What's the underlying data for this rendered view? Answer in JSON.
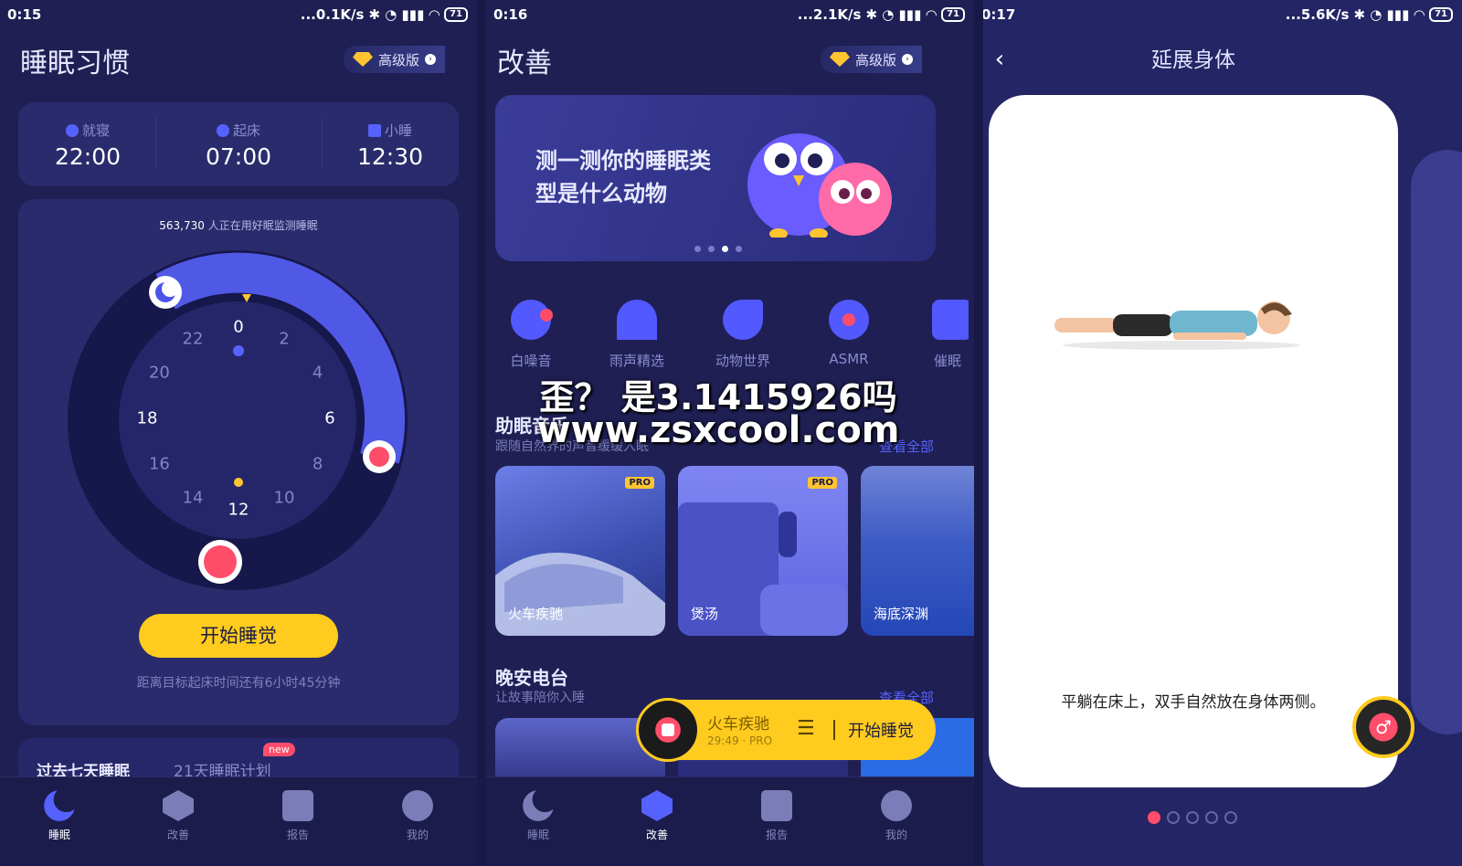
{
  "colors": {
    "accent": "#5562ff",
    "button": "#ffcb1f",
    "alert": "#ff4d6a",
    "bg": "#1f1f54"
  },
  "screen1": {
    "status": {
      "time": "0:15",
      "net": "...0.1K/s",
      "battery": "71"
    },
    "title": "睡眠习惯",
    "pro_label": "高级版",
    "bedtime": {
      "label": "就寝",
      "value": "22:00"
    },
    "wake": {
      "label": "起床",
      "value": "07:00"
    },
    "nap": {
      "label": "小睡",
      "value": "12:30"
    },
    "monitor_count": "563,730",
    "monitor_text": "人正在用好眠监测睡眠",
    "dial_numbers": [
      "0",
      "2",
      "4",
      "6",
      "8",
      "10",
      "12",
      "14",
      "16",
      "18",
      "20",
      "22"
    ],
    "start_button": "开始睡觉",
    "countdown": "距离目标起床时间还有6小时45分钟",
    "tab_past": "过去七天睡眠",
    "tab_plan": "21天睡眠计划",
    "new_badge": "new"
  },
  "screen2": {
    "status": {
      "time": "0:16",
      "net": "...2.1K/s",
      "battery": "71"
    },
    "title": "改善",
    "pro_label": "高级版",
    "banner_text": "测一测你的睡眠类型是什么动物",
    "categories": [
      {
        "label": "白噪音",
        "icon": "white-noise-icon"
      },
      {
        "label": "雨声精选",
        "icon": "umbrella-icon"
      },
      {
        "label": "动物世界",
        "icon": "bird-icon"
      },
      {
        "label": "ASMR",
        "icon": "asmr-icon"
      },
      {
        "label": "催眠",
        "icon": "hypnosis-icon"
      }
    ],
    "music_title": "助眠音乐",
    "music_sub": "跟随自然界的声音缓缓入眠",
    "more": "查看全部",
    "music_cards": [
      {
        "name": "火车疾驰",
        "pro": "PRO"
      },
      {
        "name": "煲汤",
        "pro": "PRO"
      },
      {
        "name": "海底深渊",
        "pro": ""
      }
    ],
    "radio_title": "晚安电台",
    "radio_sub": "让故事陪你入睡",
    "radio_more": "查看全部",
    "player": {
      "title": "火车疾驰",
      "sub": "29:49 · PRO",
      "button": "开始睡觉"
    }
  },
  "screen3": {
    "status": {
      "time": "0:17",
      "net": "...5.6K/s",
      "battery": "71"
    },
    "title": "延展身体",
    "instruction": "平躺在床上，双手自然放在身体两侧。",
    "pages": 5,
    "current_page": 1
  },
  "tabs": [
    "睡眠",
    "改善",
    "报告",
    "我的"
  ],
  "watermark": {
    "line1": "歪？ 是3.1415926吗",
    "line2": "www.zsxcool.com"
  }
}
